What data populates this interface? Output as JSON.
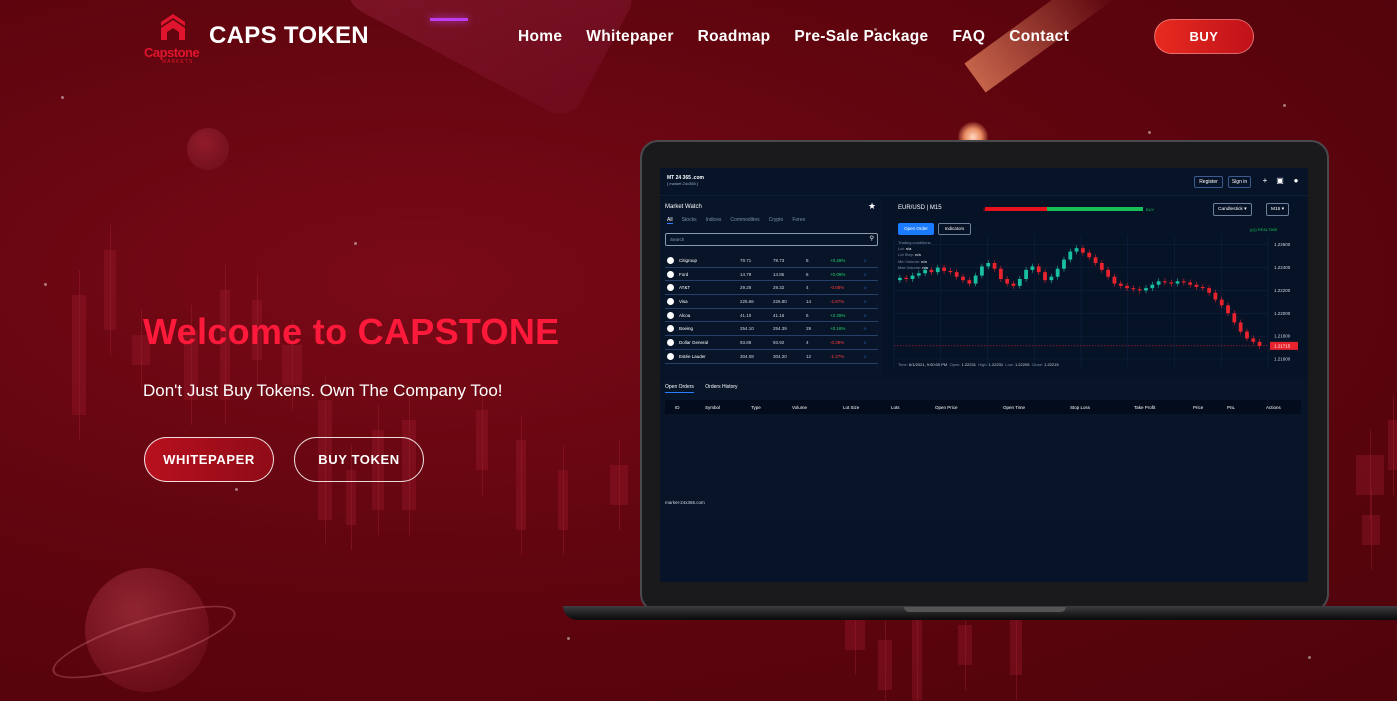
{
  "header": {
    "logo_text": "Capstone",
    "logo_sub": "MARKETS",
    "brand": "CAPS TOKEN",
    "nav": [
      "Home",
      "Whitepaper",
      "Roadmap",
      "Pre-Sale Package",
      "FAQ",
      "Contact"
    ],
    "buy_label": "BUY"
  },
  "hero": {
    "title": "Welcome to CAPSTONE",
    "subtitle": "Don't Just Buy Tokens. Own The Company Too!",
    "whitepaper_label": "WHITEPAPER",
    "buy_token_label": "BUY TOKEN"
  },
  "colors": {
    "background": "#62050f",
    "accent_red": "#ff1a3c",
    "buy_button": "#e82a1f",
    "platform_bg": "#061226",
    "positive": "#22d36a",
    "negative": "#ff3b3b"
  },
  "platform": {
    "logo_main": "MT 24 365 .com",
    "logo_sub": "[ market 24x365 ]",
    "register_label": "Register",
    "signin_label": "Sign in",
    "market_watch": {
      "title": "Market Watch",
      "tabs": [
        "All",
        "Stocks",
        "Indices",
        "Commodities",
        "Crypto",
        "Forex"
      ],
      "search_placeholder": "Search",
      "rows": [
        {
          "name": "Citigroup",
          "bid": "79.71",
          "ask": "79.73",
          "spread": "8",
          "change": "+0.28%",
          "dir": "pos"
        },
        {
          "name": "Ford",
          "bid": "14.79",
          "ask": "14.85",
          "spread": "6",
          "change": "+0.09%",
          "dir": "pos"
        },
        {
          "name": "AT&T",
          "bid": "29.28",
          "ask": "29.32",
          "spread": "4",
          "change": "-0.08%",
          "dir": "neg"
        },
        {
          "name": "Visa",
          "bid": "225.66",
          "ask": "226.80",
          "spread": "14",
          "change": "-2.87%",
          "dir": "neg"
        },
        {
          "name": "Alcoa",
          "bid": "41.10",
          "ask": "41.16",
          "spread": "6",
          "change": "+2.26%",
          "dir": "pos"
        },
        {
          "name": "Boeing",
          "bid": "254.10",
          "ask": "254.39",
          "spread": "29",
          "change": "+0.16%",
          "dir": "pos"
        },
        {
          "name": "Dollar General",
          "bid": "93.88",
          "ask": "93.92",
          "spread": "4",
          "change": "-0.39%",
          "dir": "neg"
        },
        {
          "name": "Estée Lauder",
          "bid": "304.08",
          "ask": "304.20",
          "spread": "12",
          "change": "-1.27%",
          "dir": "neg"
        }
      ]
    },
    "chart": {
      "symbol": "EUR/USD | M15",
      "sell_label": "SELL",
      "buy_label": "BUY",
      "chart_type": "Candlestick",
      "timeframe": "M15",
      "open_order_label": "Open Order",
      "indicators_label": "Indicators",
      "realtime_label": "REALTIME",
      "conditions_title": "Trading conditions",
      "conditions": [
        {
          "label": "Lot:",
          "value": "n/a"
        },
        {
          "label": "Lot Step:",
          "value": "n/a"
        },
        {
          "label": "Min Volume:",
          "value": "n/a"
        },
        {
          "label": "Max Volume:",
          "value": "n/a"
        }
      ],
      "y_ticks": [
        "1.22600",
        "1.22400",
        "1.22200",
        "1.22000",
        "1.21800",
        "1.21600"
      ],
      "current_price": "1.21715",
      "status": {
        "time_label": "Time:",
        "time": "6/1/2021, 9:00:00 PM",
        "open_label": "Open:",
        "open": "1.22231",
        "high_label": "High:",
        "high": "1.22231",
        "low_label": "Low:",
        "low": "1.22205",
        "close_label": "Close:",
        "close": "1.22215"
      }
    },
    "orders": {
      "tabs": [
        "Open Orders",
        "Orders History"
      ],
      "columns": [
        "ID",
        "Symbol",
        "Type",
        "Volume",
        "Lot Size",
        "Lots",
        "Open Price",
        "Open Time",
        "Stop Loss",
        "Take Profit",
        "Price",
        "PnL",
        "Actions"
      ],
      "footer": "market-24x365.com"
    }
  },
  "chart_data": {
    "type": "line",
    "x": [],
    "series": [
      {
        "values": [
          1.2231,
          1.223,
          1.2233,
          1.2235,
          1.2238,
          1.2236,
          1.224,
          1.2237,
          1.2236,
          1.2232,
          1.2229,
          1.2226,
          1.2233,
          1.2241,
          1.2244,
          1.2239,
          1.223,
          1.2226,
          1.2224,
          1.223,
          1.2238,
          1.2241,
          1.2236,
          1.2229,
          1.2232,
          1.2239,
          1.2247,
          1.2254,
          1.2257,
          1.2253,
          1.2249,
          1.2244,
          1.2238,
          1.2232,
          1.2226,
          1.2224,
          1.2222,
          1.2221,
          1.222,
          1.2222,
          1.2225,
          1.2228,
          1.2227,
          1.2226,
          1.2228,
          1.2227,
          1.2225,
          1.2223,
          1.2222,
          1.2218,
          1.2212,
          1.2207,
          1.22,
          1.2192,
          1.2184,
          1.2178,
          1.2175,
          1.21715
        ]
      }
    ],
    "ylim": [
      1.216,
      1.2265
    ],
    "grid": true
  }
}
